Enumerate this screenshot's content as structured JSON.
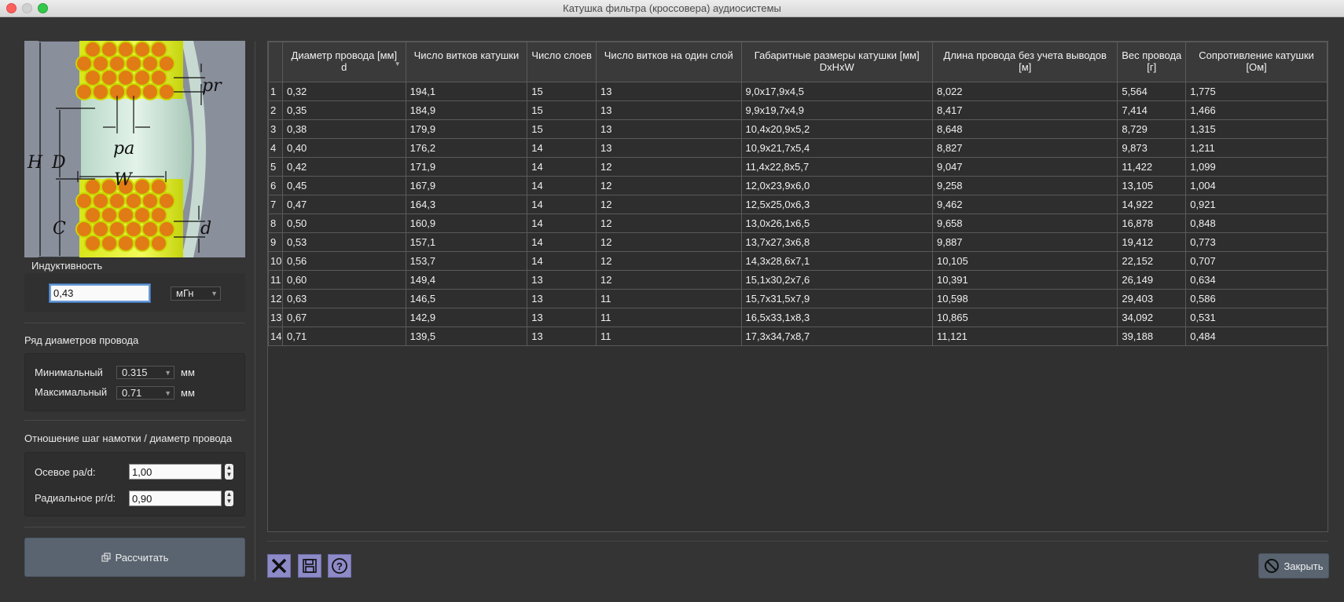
{
  "window": {
    "title": "Катушка фильтра (кроссовера) аудиосистемы"
  },
  "diagram": {
    "labels": {
      "pr": "pr",
      "pa": "pa",
      "H": "H",
      "D": "D",
      "W": "W",
      "C": "C",
      "d": "d"
    }
  },
  "inductance": {
    "label": "Индуктивность",
    "value": "0,43",
    "unit": "мГн"
  },
  "wire_range": {
    "title": "Ряд диаметров провода",
    "min_label": "Минимальный",
    "min_value": "0.315",
    "min_unit": "мм",
    "max_label": "Максимальный",
    "max_value": "0.71",
    "max_unit": "мм"
  },
  "ratio": {
    "title": "Отношение шаг намотки / диаметр провода",
    "axial_label": "Осевое pa/d:",
    "axial_value": "1,00",
    "radial_label": "Радиальное pr/d:",
    "radial_value": "0,90"
  },
  "calc_button": {
    "label": "Рассчитать"
  },
  "close_button": {
    "label": "Закрыть"
  },
  "table": {
    "headers": [
      {
        "line1": "Диаметр провода [мм]",
        "line2": "d"
      },
      {
        "line1": "Число витков катушки",
        "line2": ""
      },
      {
        "line1": "Число слоев",
        "line2": ""
      },
      {
        "line1": "Число витков на один слой",
        "line2": ""
      },
      {
        "line1": "Габаритные размеры катушки [мм]",
        "line2": "DxHxW"
      },
      {
        "line1": "Длина провода без учета выводов",
        "line2": "[м]"
      },
      {
        "line1": "Вес провода",
        "line2": "[г]"
      },
      {
        "line1": "Сопротивление катушки",
        "line2": "[Ом]"
      }
    ],
    "rows": [
      [
        "1",
        "0,32",
        "194,1",
        "15",
        "13",
        "9,0x17,9x4,5",
        "8,022",
        "5,564",
        "1,775"
      ],
      [
        "2",
        "0,35",
        "184,9",
        "15",
        "13",
        "9,9x19,7x4,9",
        "8,417",
        "7,414",
        "1,466"
      ],
      [
        "3",
        "0,38",
        "179,9",
        "15",
        "13",
        "10,4x20,9x5,2",
        "8,648",
        "8,729",
        "1,315"
      ],
      [
        "4",
        "0,40",
        "176,2",
        "14",
        "13",
        "10,9x21,7x5,4",
        "8,827",
        "9,873",
        "1,211"
      ],
      [
        "5",
        "0,42",
        "171,9",
        "14",
        "12",
        "11,4x22,8x5,7",
        "9,047",
        "11,422",
        "1,099"
      ],
      [
        "6",
        "0,45",
        "167,9",
        "14",
        "12",
        "12,0x23,9x6,0",
        "9,258",
        "13,105",
        "1,004"
      ],
      [
        "7",
        "0,47",
        "164,3",
        "14",
        "12",
        "12,5x25,0x6,3",
        "9,462",
        "14,922",
        "0,921"
      ],
      [
        "8",
        "0,50",
        "160,9",
        "14",
        "12",
        "13,0x26,1x6,5",
        "9,658",
        "16,878",
        "0,848"
      ],
      [
        "9",
        "0,53",
        "157,1",
        "14",
        "12",
        "13,7x27,3x6,8",
        "9,887",
        "19,412",
        "0,773"
      ],
      [
        "10",
        "0,56",
        "153,7",
        "14",
        "12",
        "14,3x28,6x7,1",
        "10,105",
        "22,152",
        "0,707"
      ],
      [
        "11",
        "0,60",
        "149,4",
        "13",
        "12",
        "15,1x30,2x7,6",
        "10,391",
        "26,149",
        "0,634"
      ],
      [
        "12",
        "0,63",
        "146,5",
        "13",
        "11",
        "15,7x31,5x7,9",
        "10,598",
        "29,403",
        "0,586"
      ],
      [
        "13",
        "0,67",
        "142,9",
        "13",
        "11",
        "16,5x33,1x8,3",
        "10,865",
        "34,092",
        "0,531"
      ],
      [
        "14",
        "0,71",
        "139,5",
        "13",
        "11",
        "17,3x34,7x8,7",
        "11,121",
        "39,188",
        "0,484"
      ]
    ]
  },
  "toolbar": {
    "icons": [
      "close-x-icon",
      "save-disk-icon",
      "help-icon"
    ]
  }
}
